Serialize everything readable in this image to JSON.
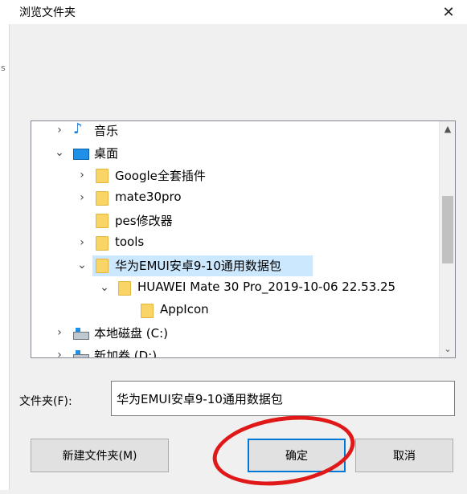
{
  "dialog": {
    "title": "浏览文件夹",
    "close_glyph": "✕",
    "left_mark": "s"
  },
  "tree": {
    "items": [
      {
        "label": "音乐",
        "icon": "music-note-icon",
        "expander": "›",
        "indent": 0
      },
      {
        "label": "桌面",
        "icon": "desktop-icon",
        "expander": "⌄",
        "indent": 0
      },
      {
        "label": "Google全套插件",
        "icon": "folder-icon",
        "expander": "›",
        "indent": 1
      },
      {
        "label": "mate30pro",
        "icon": "folder-icon",
        "expander": "›",
        "indent": 1
      },
      {
        "label": "pes修改器",
        "icon": "folder-icon",
        "expander": "",
        "indent": 1
      },
      {
        "label": "tools",
        "icon": "folder-icon",
        "expander": "›",
        "indent": 1
      },
      {
        "label": "华为EMUI安卓9-10通用数据包",
        "icon": "folder-icon",
        "expander": "⌄",
        "indent": 1,
        "selected": true
      },
      {
        "label": "HUAWEI Mate 30 Pro_2019-10-06 22.53.25",
        "icon": "folder-icon",
        "expander": "⌄",
        "indent": 2
      },
      {
        "label": "AppIcon",
        "icon": "folder-icon",
        "expander": "",
        "indent": 3
      },
      {
        "label": "本地磁盘 (C:)",
        "icon": "drive-icon",
        "expander": "›",
        "indent": 0
      },
      {
        "label": "新加卷 (D:)",
        "icon": "drive-icon",
        "expander": "›",
        "indent": 0
      }
    ],
    "scroll_up": "▲",
    "scroll_down": "⌄"
  },
  "folder_field": {
    "label": "文件夹(F):",
    "value": "华为EMUI安卓9-10通用数据包"
  },
  "buttons": {
    "new_folder": "新建文件夹(M)",
    "ok": "确定",
    "cancel": "取消"
  },
  "colors": {
    "selection": "#cce8ff",
    "accent": "#0078d7",
    "annotation": "#e01818"
  }
}
